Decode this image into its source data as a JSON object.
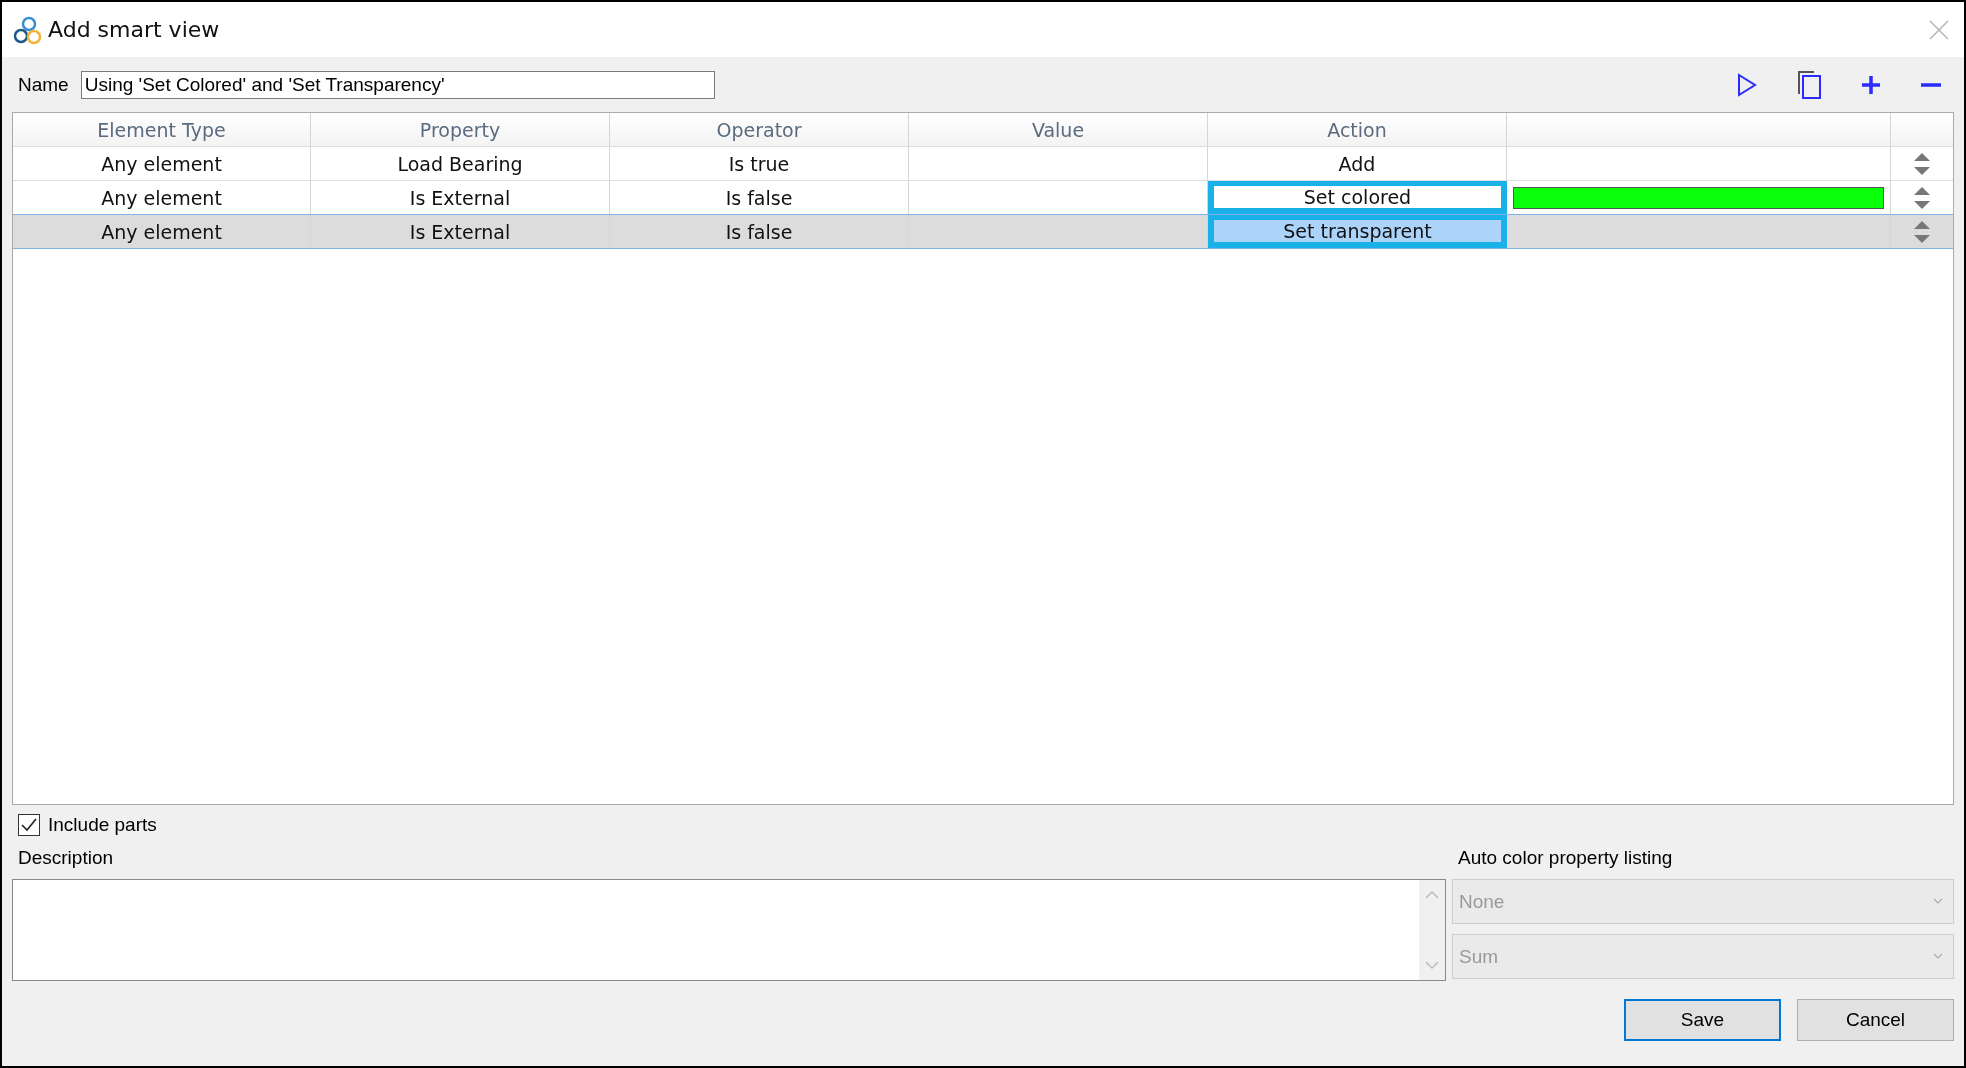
{
  "window": {
    "title": "Add smart view"
  },
  "name_field": {
    "label": "Name",
    "value": "Using 'Set Colored' and 'Set Transparency'"
  },
  "table": {
    "columns": [
      "Element Type",
      "Property",
      "Operator",
      "Value",
      "Action"
    ],
    "rows": [
      {
        "element_type": "Any element",
        "property": "Load Bearing",
        "operator": "Is true",
        "action": "Add",
        "highlighted": false,
        "selected": false
      },
      {
        "element_type": "Any element",
        "property": "Is External",
        "operator": "Is false",
        "action": "Set colored",
        "color": "#0aff0a",
        "highlighted": true,
        "selected": false
      },
      {
        "element_type": "Any element",
        "property": "Is External",
        "operator": "Is false",
        "action": "Set transparent",
        "highlighted": true,
        "selected": true
      }
    ]
  },
  "include_parts": {
    "label": "Include parts",
    "checked": true
  },
  "description": {
    "label": "Description"
  },
  "auto_color": {
    "label": "Auto color property listing",
    "dropdowns": [
      {
        "value": "None",
        "disabled": true
      },
      {
        "value": "Sum",
        "disabled": true
      }
    ]
  },
  "buttons": [
    {
      "label": "Save",
      "default": true
    },
    {
      "label": "Cancel",
      "default": false
    }
  ]
}
